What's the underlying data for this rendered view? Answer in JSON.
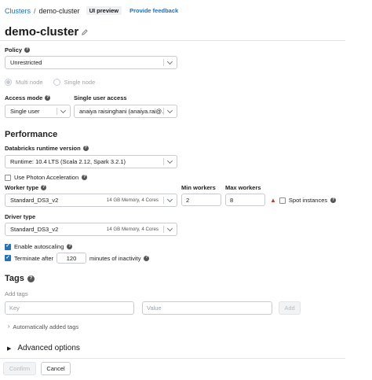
{
  "breadcrumb": {
    "clusters": "Clusters",
    "separator": "/",
    "current": "demo-cluster",
    "badge": "UI preview",
    "feedback": "Provide feedback"
  },
  "page_title": "demo-cluster",
  "policy": {
    "label": "Policy",
    "value": "Unrestricted"
  },
  "node_mode": {
    "multi": "Multi node",
    "single": "Single node"
  },
  "access_mode": {
    "label": "Access mode",
    "value": "Single user"
  },
  "single_user_access": {
    "label": "Single user access",
    "value": "anaiya raisinghani (anaiya.rai@..."
  },
  "performance": {
    "heading": "Performance",
    "runtime_label": "Databricks runtime version",
    "runtime_value": "Runtime: 10.4 LTS (Scala 2.12, Spark 3.2.1)",
    "photon_label": "Use Photon Acceleration",
    "photon_checked": false,
    "worker_type_label": "Worker type",
    "worker_type_value": "Standard_DS3_v2",
    "worker_type_meta": "14 GB Memory, 4 Cores",
    "min_workers_label": "Min workers",
    "min_workers_value": "2",
    "max_workers_label": "Max workers",
    "max_workers_value": "8",
    "spot_label": "Spot instances",
    "spot_checked": false,
    "driver_type_label": "Driver type",
    "driver_type_value": "Standard_DS3_v2",
    "driver_type_meta": "14 GB Memory, 4 Cores",
    "autoscaling_label": "Enable autoscaling",
    "autoscaling_checked": true,
    "terminate_label": "Terminate after",
    "terminate_value": "120",
    "terminate_suffix": "minutes of inactivity",
    "terminate_checked": true
  },
  "tags": {
    "heading": "Tags",
    "add_label": "Add tags",
    "key_placeholder": "Key",
    "value_placeholder": "Value",
    "add_button": "Add",
    "auto_tags": "Automatically added tags"
  },
  "advanced": {
    "label": "Advanced options"
  },
  "footer": {
    "confirm": "Confirm",
    "cancel": "Cancel"
  },
  "colors": {
    "link": "#1f6fbf",
    "checkbox": "#2272b4",
    "warning": "#c0392b"
  },
  "icons": [
    "pencil-icon",
    "help-icon",
    "chevron-down-icon",
    "warning-icon",
    "chevron-right-icon",
    "caret-right-icon",
    "check-icon"
  ]
}
